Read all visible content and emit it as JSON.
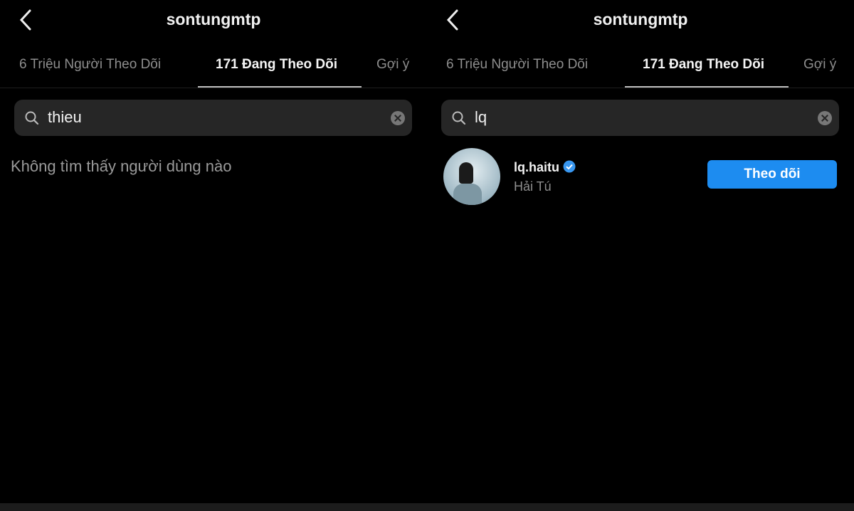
{
  "panels": [
    {
      "title": "sontungmtp",
      "tabs": [
        "6 Triệu Người Theo Dõi",
        "171 Đang Theo Dõi",
        "Gợi ý"
      ],
      "active_tab": 1,
      "search_value": "thieu",
      "empty_message": "Không tìm thấy người dùng nào"
    },
    {
      "title": "sontungmtp",
      "tabs": [
        "6 Triệu Người Theo Dõi",
        "171 Đang Theo Dõi",
        "Gợi ý"
      ],
      "active_tab": 1,
      "search_value": "lq",
      "results": [
        {
          "username": "lq.haitu",
          "verified": true,
          "full_name": "Hải Tú",
          "button": "Theo dõi"
        }
      ]
    }
  ],
  "colors": {
    "accent": "#1d8cf0",
    "background": "#000000",
    "search_bg": "#262626"
  },
  "icons": {
    "back": "chevron-left-icon",
    "search": "search-icon",
    "clear": "clear-icon",
    "verified": "verified-badge-icon"
  }
}
